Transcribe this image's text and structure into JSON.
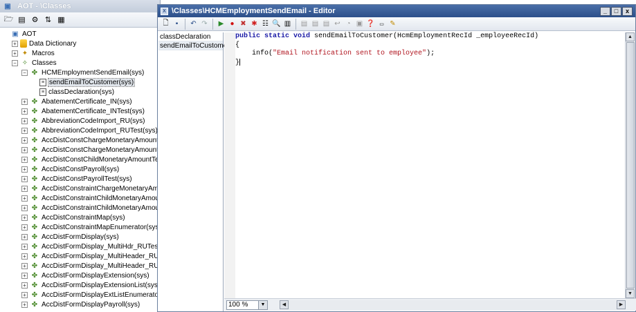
{
  "aot": {
    "title": "AOT - \\Classes",
    "tree": [
      {
        "label": "AOT",
        "level": 0,
        "icon": "aot-icon",
        "expander": ""
      },
      {
        "label": "Data Dictionary",
        "level": 1,
        "icon": "data-dictionary-icon",
        "expander": "+"
      },
      {
        "label": "Macros",
        "level": 1,
        "icon": "macros-icon",
        "expander": "+"
      },
      {
        "label": "Classes",
        "level": 1,
        "icon": "classes-icon",
        "expander": "−"
      },
      {
        "label": "HCMEmploymentSendEmail(sys)",
        "level": 2,
        "icon": "class-icon",
        "expander": "−"
      },
      {
        "label": "sendEmailToCustomer(sys)",
        "level": 3,
        "icon": "method-icon",
        "expander": "",
        "selected": true
      },
      {
        "label": "classDeclaration(sys)",
        "level": 3,
        "icon": "method-icon",
        "expander": ""
      },
      {
        "label": "AbatementCertificate_IN(sys)",
        "level": 2,
        "icon": "class-icon",
        "expander": "+"
      },
      {
        "label": "AbatementCertificate_INTest(sys)",
        "level": 2,
        "icon": "class-icon",
        "expander": "+"
      },
      {
        "label": "AbbreviationCodeImport_RU(sys)",
        "level": 2,
        "icon": "class-icon",
        "expander": "+"
      },
      {
        "label": "AbbreviationCodeImport_RUTest(sys)",
        "level": 2,
        "icon": "class-icon",
        "expander": "+"
      },
      {
        "label": "AccDistConstChargeMonetaryAmountTest",
        "level": 2,
        "icon": "class-icon",
        "expander": "+"
      },
      {
        "label": "AccDistConstChargeMonetaryAmountTest",
        "level": 2,
        "icon": "class-icon",
        "expander": "+"
      },
      {
        "label": "AccDistConstChildMonetaryAmountTestab",
        "level": 2,
        "icon": "class-icon",
        "expander": "+"
      },
      {
        "label": "AccDistConstPayroll(sys)",
        "level": 2,
        "icon": "class-icon",
        "expander": "+"
      },
      {
        "label": "AccDistConstPayrollTest(sys)",
        "level": 2,
        "icon": "class-icon",
        "expander": "+"
      },
      {
        "label": "AccDistConstraintChargeMonetaryAmount",
        "level": 2,
        "icon": "class-icon",
        "expander": "+"
      },
      {
        "label": "AccDistConstraintChildMonetaryAmount(s",
        "level": 2,
        "icon": "class-icon",
        "expander": "+"
      },
      {
        "label": "AccDistConstraintChildMonetaryAmountTe",
        "level": 2,
        "icon": "class-icon",
        "expander": "+"
      },
      {
        "label": "AccDistConstraintMap(sys)",
        "level": 2,
        "icon": "class-icon",
        "expander": "+"
      },
      {
        "label": "AccDistConstraintMapEnumerator(sys)",
        "level": 2,
        "icon": "class-icon",
        "expander": "+"
      },
      {
        "label": "AccDistFormDisplay(sys)",
        "level": 2,
        "icon": "class-icon",
        "expander": "+"
      },
      {
        "label": "AccDistFormDisplay_MultiHdr_RUTestable(",
        "level": 2,
        "icon": "class-icon",
        "expander": "+"
      },
      {
        "label": "AccDistFormDisplay_MultiHeader_RU(sys)",
        "level": 2,
        "icon": "class-icon",
        "expander": "+"
      },
      {
        "label": "AccDistFormDisplay_MultiHeader_RUTest(",
        "level": 2,
        "icon": "class-icon",
        "expander": "+"
      },
      {
        "label": "AccDistFormDisplayExtension(sys)",
        "level": 2,
        "icon": "class-icon",
        "expander": "+"
      },
      {
        "label": "AccDistFormDisplayExtensionList(sys)",
        "level": 2,
        "icon": "class-icon",
        "expander": "+"
      },
      {
        "label": "AccDistFormDisplayExtListEnumerator(sys",
        "level": 2,
        "icon": "class-icon",
        "expander": "+"
      },
      {
        "label": "AccDistFormDisplayPayroll(sys)",
        "level": 2,
        "icon": "class-icon",
        "expander": "+"
      }
    ]
  },
  "editor": {
    "title": "\\Classes\\HCMEmploymentSendEmail - Editor",
    "window_buttons": {
      "minimize": "_",
      "maximize": "□",
      "close": "x"
    },
    "methods": [
      "classDeclaration",
      "sendEmailToCustomer"
    ],
    "active_method_index": 1,
    "code": {
      "line1_kw": "public static void",
      "line1_rest": " sendEmailToCustomer(HcmEmploymentRecId _employeeRecId)",
      "line2": "{",
      "line3_prefix": "    info(",
      "line3_string": "\"Email notification sent to employee\"",
      "line3_suffix": ");",
      "line4": "}"
    },
    "zoom": "100 %"
  },
  "colors": {
    "editor_title_bg": "#2c4f8a",
    "keyword": "#1a1aa6",
    "string": "#b0141e"
  }
}
